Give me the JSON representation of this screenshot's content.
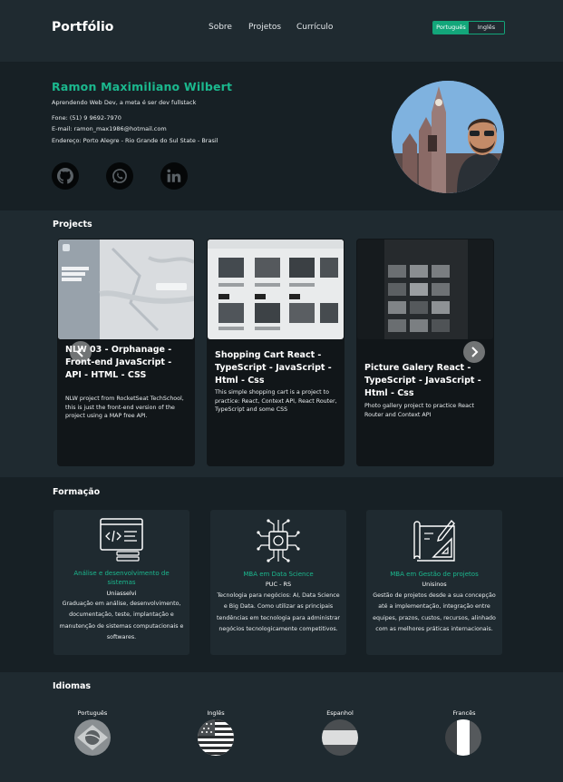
{
  "header": {
    "brand": "Portfólio",
    "nav": [
      "Sobre",
      "Projetos",
      "Currículo"
    ],
    "lang_pt": "Português",
    "lang_en": "Inglês"
  },
  "hero": {
    "name": "Ramon Maximiliano Wilbert",
    "tagline": "Aprendendo Web Dev, a meta é ser dev fullstack",
    "phone": "Fone: (51) 9 9692-7970",
    "email": "E-mail: ramon_max1986@hotmail.com",
    "address": "Endereço: Porto Alegre - Rio Grande do Sul State - Brasil",
    "socials": [
      "github-icon",
      "whatsapp-icon",
      "linkedin-icon"
    ]
  },
  "projects": {
    "title": "Projects",
    "items": [
      {
        "title": "NLW 03 - Orphanage - Front-end JavaScript - API - HTML - CSS",
        "desc": "NLW project from RocketSeat TechSchool, this is just the front-end version of the project using a MAP free API."
      },
      {
        "title": "Shopping Cart React - TypeScript - JavaScript - Html - Css",
        "desc": "This simple shopping cart is a project to practice: React, Context API, React Router, TypeScript and some CSS"
      },
      {
        "title": "Picture Galery React - TypeScript - JavaScript - Html - Css",
        "desc": "Photo gallery project to practice React Router and Context API"
      }
    ]
  },
  "formacao": {
    "title": "Formação",
    "items": [
      {
        "title": "Análise e desenvolvimento de sistemas",
        "school": "Uniasselvi",
        "desc": "Graduação em análise, desenvolvimento, documentação, teste, implantação e manutenção de sistemas computacionais e softwares."
      },
      {
        "title": "MBA em Data Science",
        "school": "PUC - RS",
        "desc": "Tecnologia para negócios: AI, Data Science e Big Data. Como utilizar as principais tendências em tecnologia para administrar negócios tecnologicamente competitivos."
      },
      {
        "title": "MBA em Gestão de projetos",
        "school": "Unisinos",
        "desc": "Gestão de projetos desde a sua concepção até a implementação, integração entre equipes, prazos, custos, recursos, alinhado com as melhores práticas internacionais."
      }
    ]
  },
  "idiomas": {
    "title": "Idiomas",
    "items": [
      "Português",
      "Inglês",
      "Espanhol",
      "Francês"
    ]
  },
  "colors": {
    "accent": "#1bb88e",
    "background": "#1f2a30",
    "band": "#172025",
    "card": "#111619"
  }
}
